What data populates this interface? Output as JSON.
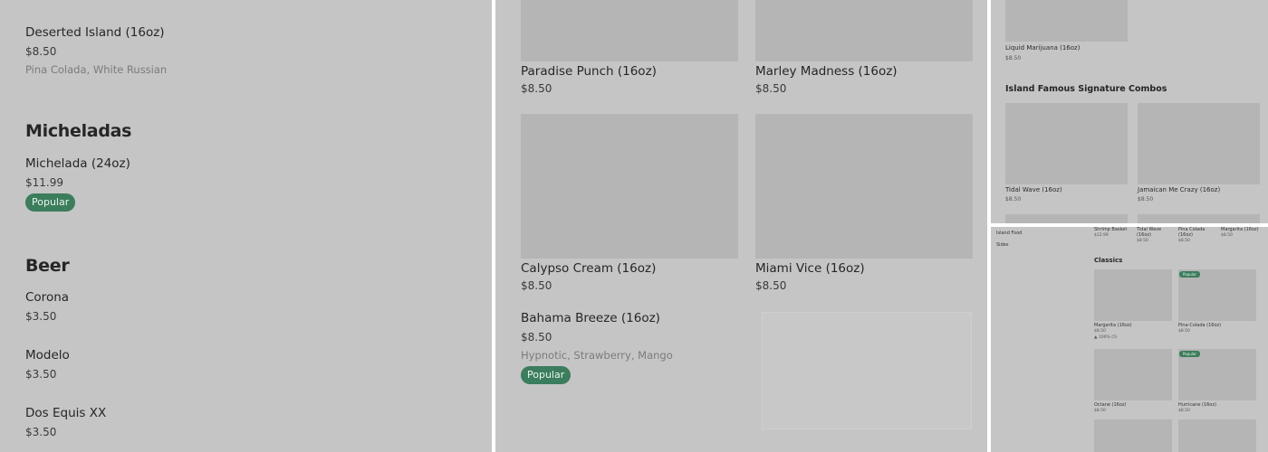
{
  "panel1": {
    "top_item": {
      "name": "Deserted Island (16oz)",
      "price": "$8.50",
      "desc": "Pina Colada, White Russian"
    },
    "micheladas": {
      "title": "Micheladas",
      "items": [
        {
          "name": "Michelada (24oz)",
          "price": "$11.99",
          "badge": "Popular"
        }
      ]
    },
    "beer": {
      "title": "Beer",
      "items": [
        {
          "name": "Corona",
          "price": "$3.50"
        },
        {
          "name": "Modelo",
          "price": "$3.50"
        },
        {
          "name": "Dos Equis XX",
          "price": "$3.50"
        }
      ]
    }
  },
  "panel2": {
    "grid": [
      {
        "name": "Paradise Punch (16oz)",
        "price": "$8.50"
      },
      {
        "name": "Marley Madness (16oz)",
        "price": "$8.50"
      },
      {
        "name": "Calypso Cream (16oz)",
        "price": "$8.50"
      },
      {
        "name": "Miami Vice (16oz)",
        "price": "$8.50"
      }
    ],
    "featured": {
      "name": "Bahama Breeze (16oz)",
      "price": "$8.50",
      "desc": "Hypnotic, Strawberry, Mango",
      "badge": "Popular"
    }
  },
  "panel3": {
    "top_item": {
      "name": "Liquid Marijuana (16oz)",
      "price": "$8.50"
    },
    "section_title": "Island Famous Signature Combos",
    "items": [
      {
        "name": "Tidal Wave (16oz)",
        "price": "$8.50"
      },
      {
        "name": "Jamaican Me Crazy (16oz)",
        "price": "$8.50"
      }
    ]
  },
  "panel4": {
    "nav": [
      "Island Food",
      "Sides"
    ],
    "top_row": [
      {
        "name": "Shrimp Basket",
        "price": "$12.99"
      },
      {
        "name": "Tidal Wave (16oz)",
        "price": "$8.50"
      },
      {
        "name": "Pina Colada (16oz)",
        "price": "$8.50"
      },
      {
        "name": "Margarita (16oz)",
        "price": "$8.50"
      }
    ],
    "section_title": "Classics",
    "items": [
      {
        "name": "Margarita (16oz)",
        "price": "$8.50",
        "rating": "100% (5)"
      },
      {
        "name": "Pina-Colada (16oz)",
        "price": "$8.50",
        "badge": "Popular"
      },
      {
        "name": "Octane (16oz)",
        "price": "$8.50"
      },
      {
        "name": "Hurricane (16oz)",
        "price": "$8.50",
        "badge": "Popular"
      }
    ]
  },
  "colors": {
    "overlay": "#c5c5c5",
    "badge": "#3b7d5c",
    "image_placeholder": "#b5b5b5"
  }
}
